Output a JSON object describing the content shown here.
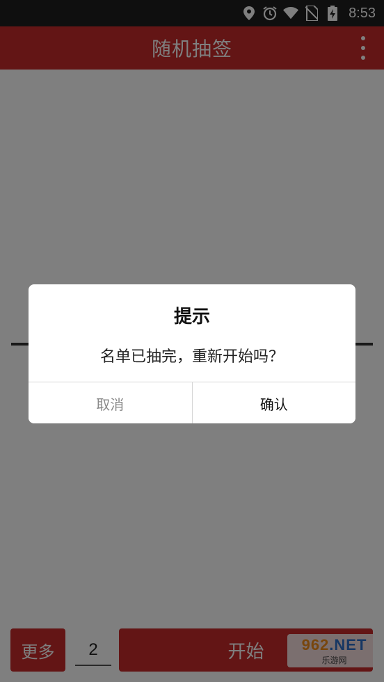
{
  "status_bar": {
    "time": "8:53",
    "icons": [
      "location-icon",
      "alarm-icon",
      "wifi-icon",
      "no-sim-icon",
      "battery-charging-icon"
    ]
  },
  "app_bar": {
    "title": "随机抽签",
    "overflow_icon": "more-vertical-icon"
  },
  "bottom_bar": {
    "more_label": "更多",
    "count_value": "2",
    "start_label": "开始"
  },
  "dialog": {
    "title": "提示",
    "message": "名单已抽完，重新开始吗？",
    "cancel_label": "取消",
    "confirm_label": "确认"
  },
  "watermark": {
    "top_digits": "962",
    "top_suffix": ".NET",
    "bottom": "乐游网"
  },
  "colors": {
    "primary": "#c62b2b",
    "status_bar": "#1f1f1f",
    "scrim": "rgba(0,0,0,0.5)"
  }
}
